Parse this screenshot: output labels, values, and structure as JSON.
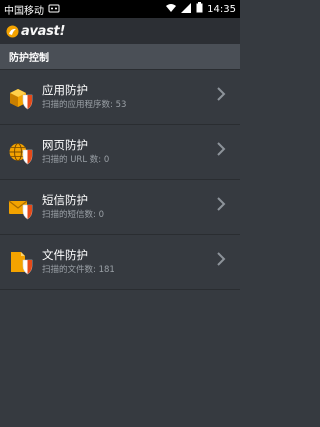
{
  "status_bar": {
    "carrier": "中国移动",
    "time": "14:35"
  },
  "app": {
    "logo_text": "avast!"
  },
  "section": {
    "title": "防护控制"
  },
  "items": [
    {
      "title": "应用防护",
      "subtitle": "扫描的应用程序数: 53",
      "icon": "app-shield-icon"
    },
    {
      "title": "网页防护",
      "subtitle": "扫描的 URL 数: 0",
      "icon": "web-shield-icon"
    },
    {
      "title": "短信防护",
      "subtitle": "扫描的短信数: 0",
      "icon": "sms-shield-icon"
    },
    {
      "title": "文件防护",
      "subtitle": "扫描的文件数: 181",
      "icon": "file-shield-icon"
    }
  ],
  "colors": {
    "accent": "#f4a300",
    "background": "#363a40",
    "header": "#4a4f56"
  }
}
